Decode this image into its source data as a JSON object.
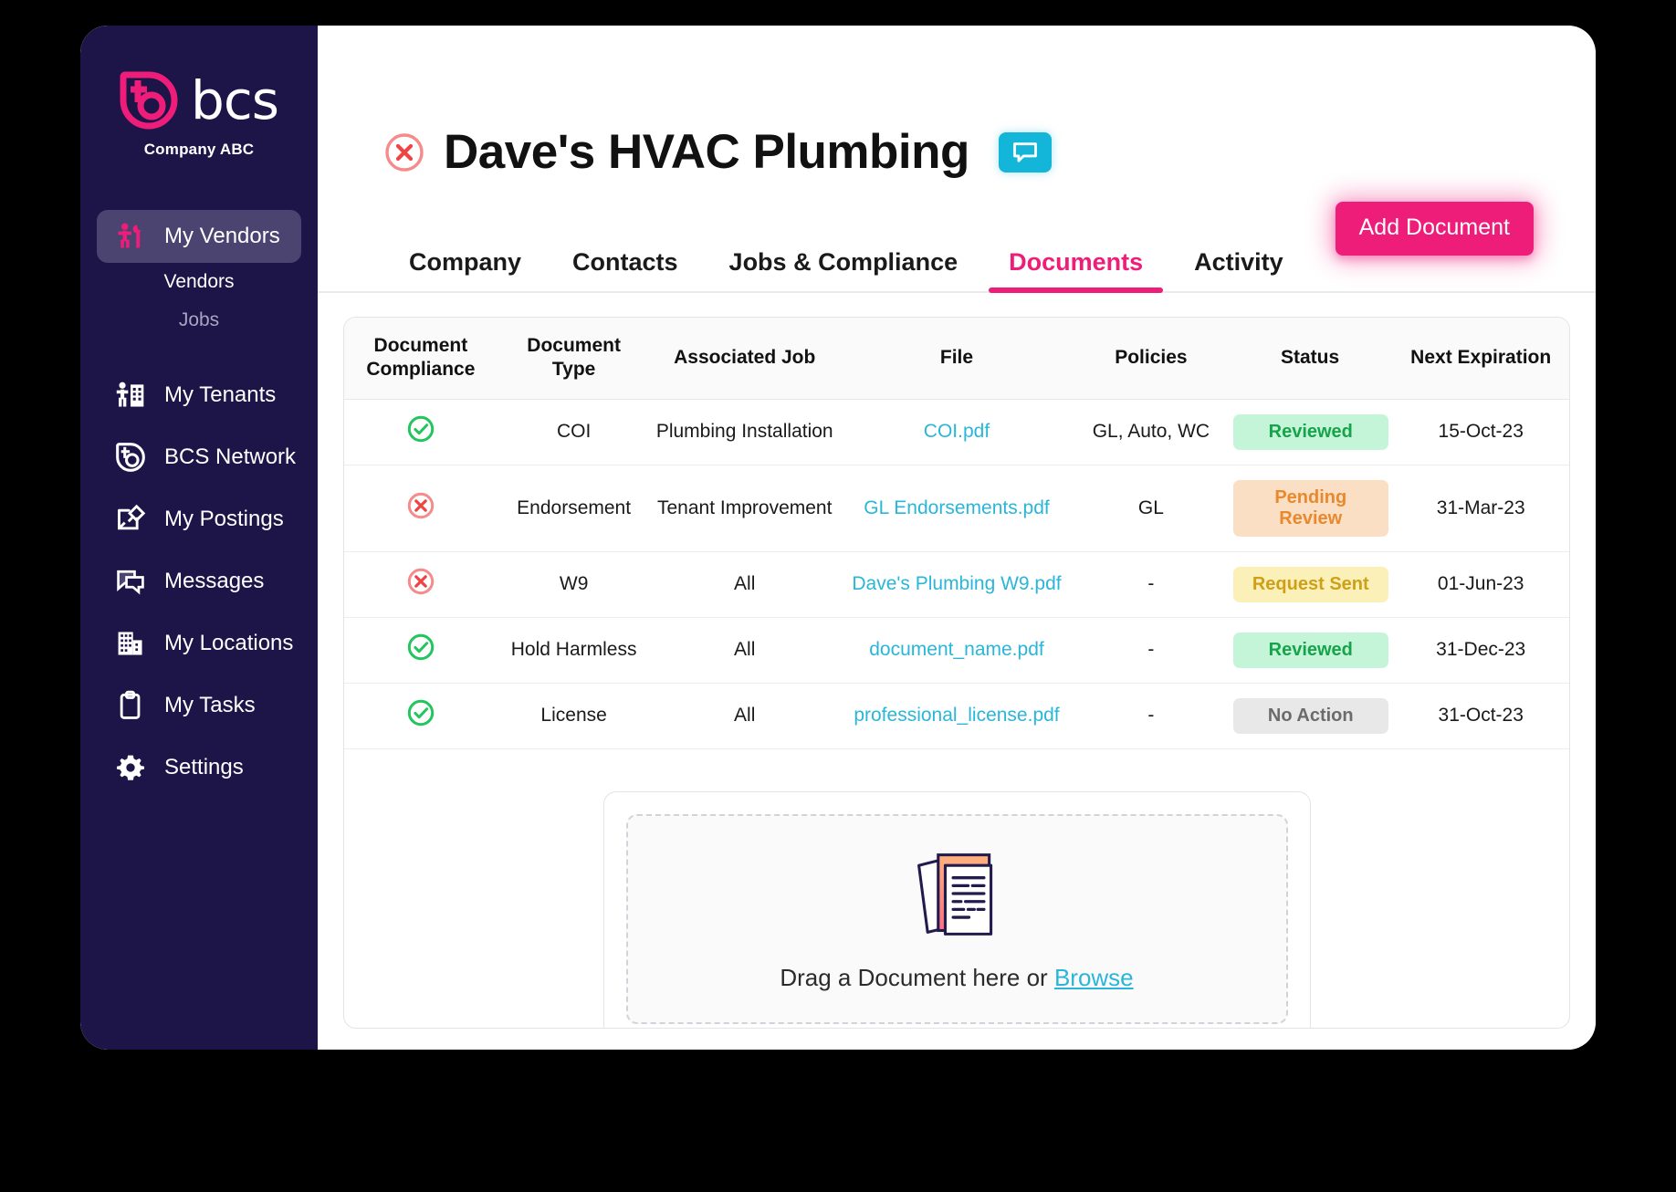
{
  "sidebar": {
    "brand": {
      "word": "bcs",
      "sub": "Company ABC",
      "logo_icon": "bcs-logo-icon"
    },
    "items": [
      {
        "label": "My Vendors",
        "icon": "worker-wrench-icon",
        "active": true
      },
      {
        "label": "My Tenants",
        "icon": "person-building-icon",
        "active": false
      },
      {
        "label": "BCS Network",
        "icon": "bcs-circle-icon",
        "active": false
      },
      {
        "label": "My Postings",
        "icon": "pin-note-icon",
        "active": false
      },
      {
        "label": "Messages",
        "icon": "chat-bubbles-icon",
        "active": false
      },
      {
        "label": "My Locations",
        "icon": "building-icon",
        "active": false
      },
      {
        "label": "My Tasks",
        "icon": "clipboard-icon",
        "active": false
      },
      {
        "label": "Settings",
        "icon": "gear-icon",
        "active": false
      }
    ],
    "subitems": [
      {
        "label": "Vendors",
        "dim": false
      },
      {
        "label": "Jobs",
        "dim": true
      }
    ]
  },
  "header": {
    "title": "Dave's HVAC Plumbing",
    "status_icon": "x-circle-icon",
    "chat_icon": "chat-bubble-icon",
    "add_document_label": "Add Document"
  },
  "tabs": [
    {
      "label": "Company",
      "active": false
    },
    {
      "label": "Contacts",
      "active": false
    },
    {
      "label": "Jobs & Compliance",
      "active": false
    },
    {
      "label": "Documents",
      "active": true
    },
    {
      "label": "Activity",
      "active": false
    }
  ],
  "table": {
    "columns": [
      "Document Compliance",
      "Document Type",
      "Associated Job",
      "File",
      "Policies",
      "Status",
      "Next Expiration"
    ],
    "rows": [
      {
        "compliance": "check-circle-icon",
        "type": "COI",
        "job": "Plumbing Installation",
        "file": "COI.pdf",
        "policies": "GL, Auto, WC",
        "status": "Reviewed",
        "status_kind": "reviewed",
        "expiration": "15-Oct-23"
      },
      {
        "compliance": "x-circle-icon",
        "type": "Endorsement",
        "job": "Tenant Improvement",
        "file": "GL Endorsements.pdf",
        "policies": "GL",
        "status": "Pending Review",
        "status_kind": "pending",
        "expiration": "31-Mar-23"
      },
      {
        "compliance": "x-circle-icon",
        "type": "W9",
        "job": "All",
        "file": "Dave's Plumbing W9.pdf",
        "policies": "-",
        "status": "Request Sent",
        "status_kind": "request",
        "expiration": "01-Jun-23"
      },
      {
        "compliance": "check-circle-icon",
        "type": "Hold Harmless",
        "job": "All",
        "file": "document_name.pdf",
        "policies": "-",
        "status": "Reviewed",
        "status_kind": "reviewed",
        "expiration": "31-Dec-23"
      },
      {
        "compliance": "check-circle-icon",
        "type": "License",
        "job": "All",
        "file": "professional_license.pdf",
        "policies": "-",
        "status": "No Action",
        "status_kind": "noaction",
        "expiration": "31-Oct-23"
      }
    ]
  },
  "dropzone": {
    "icon": "documents-stack-icon",
    "text": "Drag a Document here or ",
    "browse_label": "Browse"
  },
  "colors": {
    "brand_pink": "#ef1d7a",
    "sidebar_navy": "#1d1448",
    "link_cyan": "#29b6d8",
    "chat_cyan": "#13b5d8",
    "green": "#16a34a",
    "orange": "#e8892d",
    "yellow": "#cfa017",
    "gray": "#6b6b6b"
  }
}
